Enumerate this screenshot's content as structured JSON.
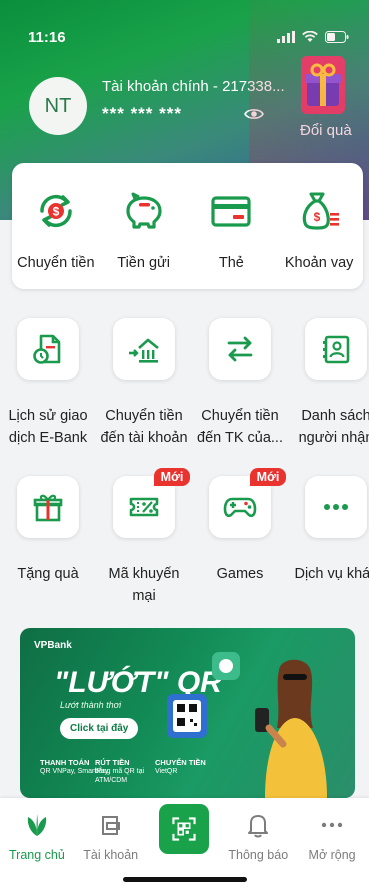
{
  "status_bar": {
    "time": "11:16"
  },
  "account": {
    "avatar_initials": "NT",
    "name": "Tài khoản chính - 217338...",
    "balance_masked": "*** *** ***",
    "reward_label": "Đổi quà"
  },
  "quick_actions": [
    {
      "label": "Chuyển tiền",
      "icon": "transfer-icon"
    },
    {
      "label": "Tiền gửi",
      "icon": "piggy-bank-icon"
    },
    {
      "label": "Thẻ",
      "icon": "card-icon"
    },
    {
      "label": "Khoản vay",
      "icon": "loan-bag-icon"
    }
  ],
  "services": [
    {
      "label": "Lịch sử giao\ndịch E-Bank",
      "icon": "history-icon"
    },
    {
      "label": "Chuyển tiền\nđến tài khoản",
      "icon": "transfer-account-icon"
    },
    {
      "label": "Chuyển tiền\nđến TK của...",
      "icon": "swap-icon"
    },
    {
      "label": "Danh sách\nngười nhận",
      "icon": "contacts-icon"
    },
    {
      "label": "Tặng quà",
      "icon": "gift-icon"
    },
    {
      "label": "Mã khuyến\nmại",
      "icon": "voucher-icon",
      "badge": "Mới"
    },
    {
      "label": "Games",
      "icon": "gamepad-icon",
      "badge": "Mới"
    },
    {
      "label": "Dịch vụ khác",
      "icon": "more-icon"
    }
  ],
  "banner": {
    "brand": "VPBank",
    "title": "\"LƯỚT\" QR",
    "subtitle": "Lướt thành thơi",
    "cta": "Click tại đây",
    "columns": [
      {
        "head": "THANH TOÁN",
        "body": "QR VNPay, SmartPay"
      },
      {
        "head": "RÚT TIỀN",
        "body": "bằng mã QR tại ATM/CDM"
      },
      {
        "head": "CHUYỂN TIỀN",
        "body": "VietQR"
      }
    ]
  },
  "bottom_nav": [
    {
      "label": "Trang chủ",
      "active": true
    },
    {
      "label": "Tài khoản"
    },
    {
      "label": ""
    },
    {
      "label": "Thông báo"
    },
    {
      "label": "Mở rộng"
    }
  ],
  "colors": {
    "primary": "#1aa24a",
    "badge": "#e8332f"
  }
}
